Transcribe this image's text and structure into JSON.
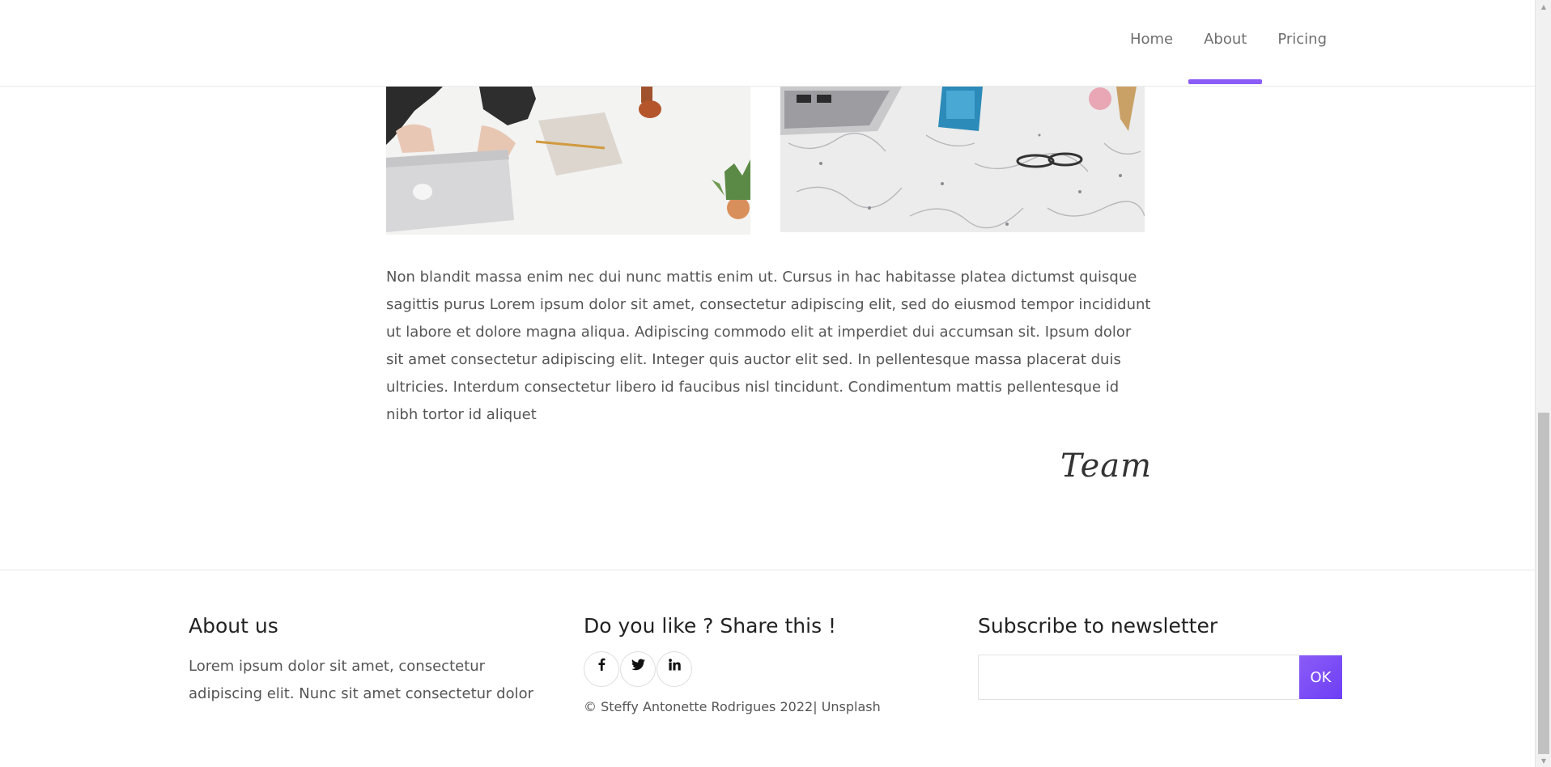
{
  "nav": {
    "items": [
      {
        "label": "Home",
        "active": false
      },
      {
        "label": "About",
        "active": true
      },
      {
        "label": "Pricing",
        "active": false
      }
    ],
    "accent_color": "#8b5cf6"
  },
  "article": {
    "body": "Non blandit massa enim nec dui nunc mattis enim ut. Cursus in hac habitasse platea dictumst quisque sagittis purus Lorem ipsum dolor sit amet, consectetur adipiscing elit, sed do eiusmod tempor incididunt ut labore et dolore magna aliqua. Adipiscing commodo elit at imperdiet dui accumsan sit. Ipsum dolor sit amet consectetur adipiscing elit. Integer quis auctor elit sed. In pellentesque massa placerat duis ultricies. Interdum consectetur libero id faucibus nisl tincidunt. Condimentum mattis pellentesque id nibh tortor id aliquet",
    "signature": "Team"
  },
  "footer": {
    "about": {
      "title": "About us",
      "text": "Lorem ipsum dolor sit amet, consectetur adipiscing elit. Nunc sit amet consectetur dolor"
    },
    "share": {
      "title": "Do you like ? Share this !",
      "icons": [
        "facebook-icon",
        "twitter-icon",
        "linkedin-icon"
      ],
      "copyright": "© Steffy Antonette Rodrigues 2022|",
      "credit_link": "Unsplash"
    },
    "newsletter": {
      "title": "Subscribe to newsletter",
      "input_value": "",
      "button_label": "OK",
      "button_color": "#7c4dfa"
    }
  }
}
